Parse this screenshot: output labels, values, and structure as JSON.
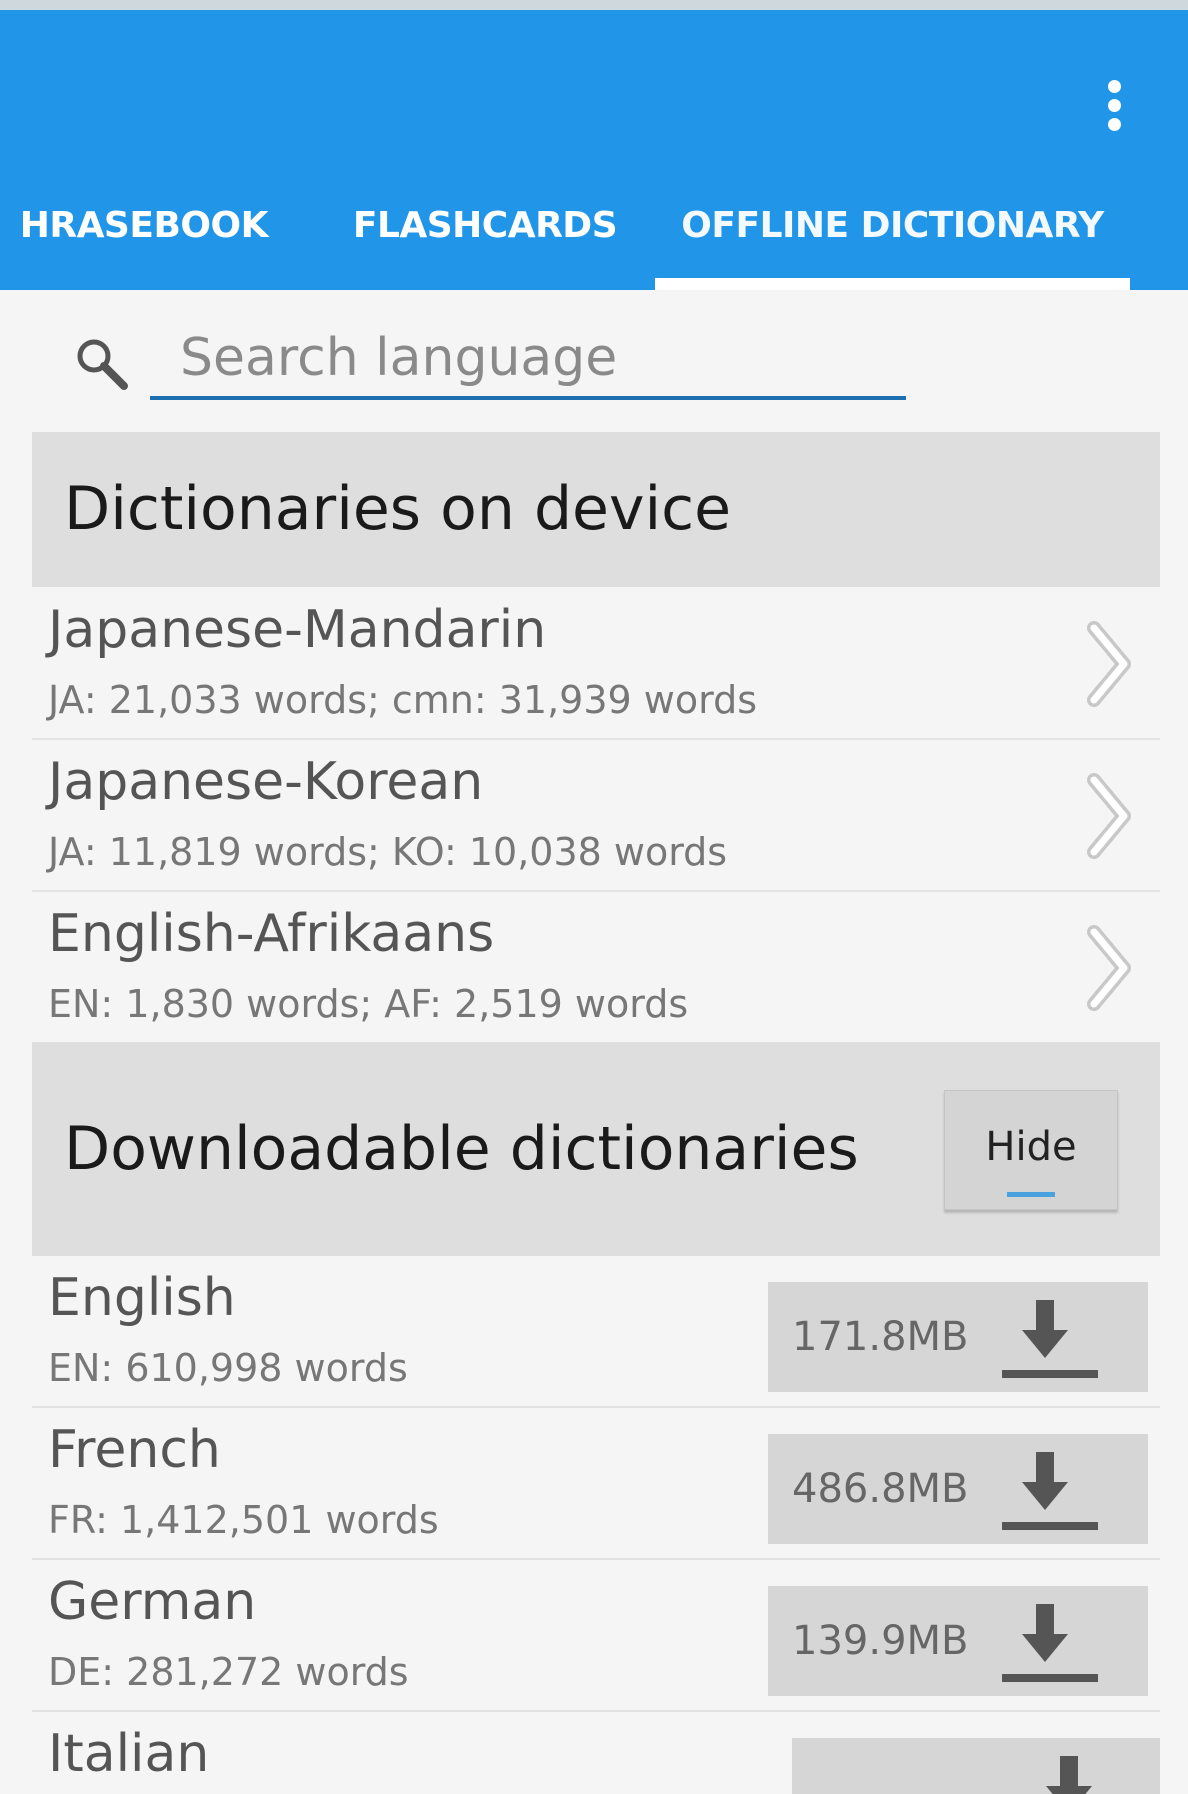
{
  "app_bar": {
    "overflow_icon": "more-vert-icon",
    "color": "#2196e8"
  },
  "tabs": [
    {
      "label": "PHRASEBOOK",
      "shown_label": "HRASEBOOK"
    },
    {
      "label": "FLASHCARDS"
    },
    {
      "label": "OFFLINE DICTIONARY",
      "selected": true
    }
  ],
  "search": {
    "placeholder": "Search language",
    "value": "",
    "icon": "search-icon"
  },
  "on_device": {
    "header": "Dictionaries on device",
    "items": [
      {
        "title": "Japanese-Mandarin",
        "subtitle": "JA: 21,033 words; cmn: 31,939 words"
      },
      {
        "title": "Japanese-Korean",
        "subtitle": "JA: 11,819 words; KO: 10,038 words"
      },
      {
        "title": "English-Afrikaans",
        "subtitle": "EN: 1,830 words; AF: 2,519 words"
      }
    ]
  },
  "downloadable": {
    "header": "Downloadable dictionaries",
    "hide_label": "Hide",
    "items": [
      {
        "title": "English",
        "subtitle": "EN: 610,998 words",
        "size": "171.8MB"
      },
      {
        "title": "French",
        "subtitle": "FR: 1,412,501 words",
        "size": "486.8MB"
      },
      {
        "title": "German",
        "subtitle": "DE: 281,272 words",
        "size": "139.9MB"
      },
      {
        "title": "Italian",
        "subtitle": "",
        "size": ""
      }
    ]
  }
}
